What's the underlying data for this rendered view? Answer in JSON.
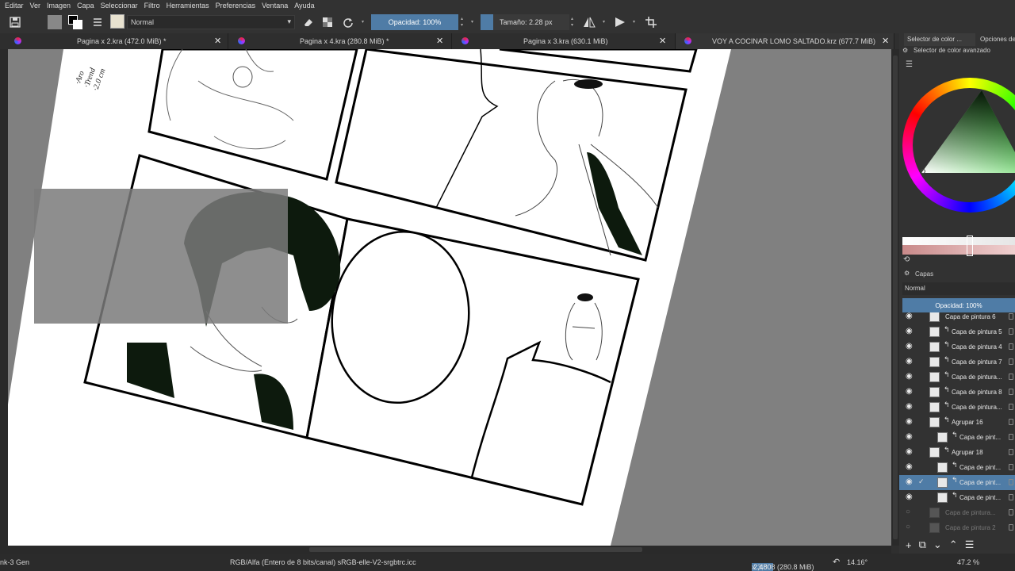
{
  "menu": [
    "Editar",
    "Ver",
    "Imagen",
    "Capa",
    "Seleccionar",
    "Filtro",
    "Herramientas",
    "Preferencias",
    "Ventana",
    "Ayuda"
  ],
  "toolbar": {
    "blend_mode": "Normal",
    "opacity_label": "Opacidad: 100%",
    "size_label": "Tamaño: 2.28 px"
  },
  "tabs": [
    {
      "title": "Pagina x 2.kra (472.0 MiB) *"
    },
    {
      "title": "Pagina x 4.kra (280.8 MiB) *"
    },
    {
      "title": "Pagina x 3.kra (630.1 MiB)"
    },
    {
      "title": "VOY A COCINAR LOMO SALTADO.krz (677.7 MiB)"
    }
  ],
  "canvas_notes": [
    "·Aro",
    "·Trend",
    "·2.0 cm"
  ],
  "dock": {
    "tab_color": "Selector de color ...",
    "tab_options": "Opciones de",
    "advanced_selector": "Selector de color avanzado",
    "layers_title": "Capas",
    "layers_blend": "Normal",
    "layers_opacity": "Opacidad:  100%"
  },
  "layers": [
    {
      "name": "Capa de pintura 6",
      "clip": false,
      "indent": 0,
      "active": false,
      "dim": false,
      "visible": true
    },
    {
      "name": "Capa de pintura 5",
      "clip": true,
      "indent": 0,
      "active": false,
      "dim": false,
      "visible": true
    },
    {
      "name": "Capa de pintura 4",
      "clip": true,
      "indent": 0,
      "active": false,
      "dim": false,
      "visible": true
    },
    {
      "name": "Capa de pintura 7",
      "clip": true,
      "indent": 0,
      "active": false,
      "dim": false,
      "visible": true
    },
    {
      "name": "Capa de pintura...",
      "clip": true,
      "indent": 0,
      "active": false,
      "dim": false,
      "visible": true
    },
    {
      "name": "Capa de pintura 8",
      "clip": true,
      "indent": 0,
      "active": false,
      "dim": false,
      "visible": true
    },
    {
      "name": "Capa de pintura...",
      "clip": true,
      "indent": 0,
      "active": false,
      "dim": false,
      "visible": true
    },
    {
      "name": "Agrupar 16",
      "clip": true,
      "indent": 0,
      "active": false,
      "dim": false,
      "visible": true
    },
    {
      "name": "Capa de pint...",
      "clip": true,
      "indent": 1,
      "active": false,
      "dim": false,
      "visible": true
    },
    {
      "name": "Agrupar 18",
      "clip": true,
      "indent": 0,
      "active": false,
      "dim": false,
      "visible": true
    },
    {
      "name": "Capa de pint...",
      "clip": true,
      "indent": 1,
      "active": false,
      "dim": false,
      "visible": true
    },
    {
      "name": "Capa de pint...",
      "clip": true,
      "indent": 1,
      "active": true,
      "dim": false,
      "visible": true
    },
    {
      "name": "Capa de pint...",
      "clip": true,
      "indent": 1,
      "active": false,
      "dim": false,
      "visible": true
    },
    {
      "name": "Capa de pintura...",
      "clip": false,
      "indent": 0,
      "active": false,
      "dim": true,
      "visible": false
    },
    {
      "name": "Capa de pintura 2",
      "clip": false,
      "indent": 0,
      "active": false,
      "dim": true,
      "visible": false
    }
  ],
  "status": {
    "brush": "nk-3 Gen",
    "color_space": "RGB/Alfa (Entero de 8 bits/canal)  sRGB-elle-V2-srgbtrc.icc",
    "dimensions_a": "2,480",
    "dimensions_b": " x 3,508 (280.8 MiB)",
    "rotation": "14.16°",
    "zoom": "47.2 %"
  },
  "colors": {
    "accent": "#4f7ca6",
    "bg": "#323232",
    "canvas_bg": "#808080"
  }
}
